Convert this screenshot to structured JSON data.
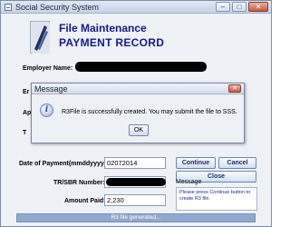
{
  "window": {
    "title": "Social Security System",
    "controls": {
      "minimize": "–",
      "maximize": "□",
      "close": "✕"
    }
  },
  "header": {
    "title": "File Maintenance",
    "subtitle": "PAYMENT RECORD"
  },
  "form": {
    "employer_name_label": "Employer Name:",
    "row2_label": "Er",
    "row3_label": "Ap",
    "row4_label": "T",
    "date_label": "Date of Payment(mmddyyyy):",
    "date_value": "02072014",
    "tr_sbr_label": "TR/SBR Number:",
    "amount_label": "Amount Paid:",
    "amount_value": "2,230"
  },
  "buttons": {
    "continue": "Continue",
    "cancel": "Cancel",
    "close": "Close"
  },
  "message_panel": {
    "title": "Message",
    "text": "Please press Continue button to create R3 file."
  },
  "status": {
    "text": "R3 file generated..."
  },
  "dialog": {
    "title": "Message",
    "close": "✕",
    "icon": "info-icon",
    "text": "R3File is successfully created. You may submit the file to SSS.",
    "ok": "OK"
  },
  "colors": {
    "header_text": "#141a8c",
    "message_text": "#1b2a9a",
    "status_bar": "#90a9cc"
  }
}
